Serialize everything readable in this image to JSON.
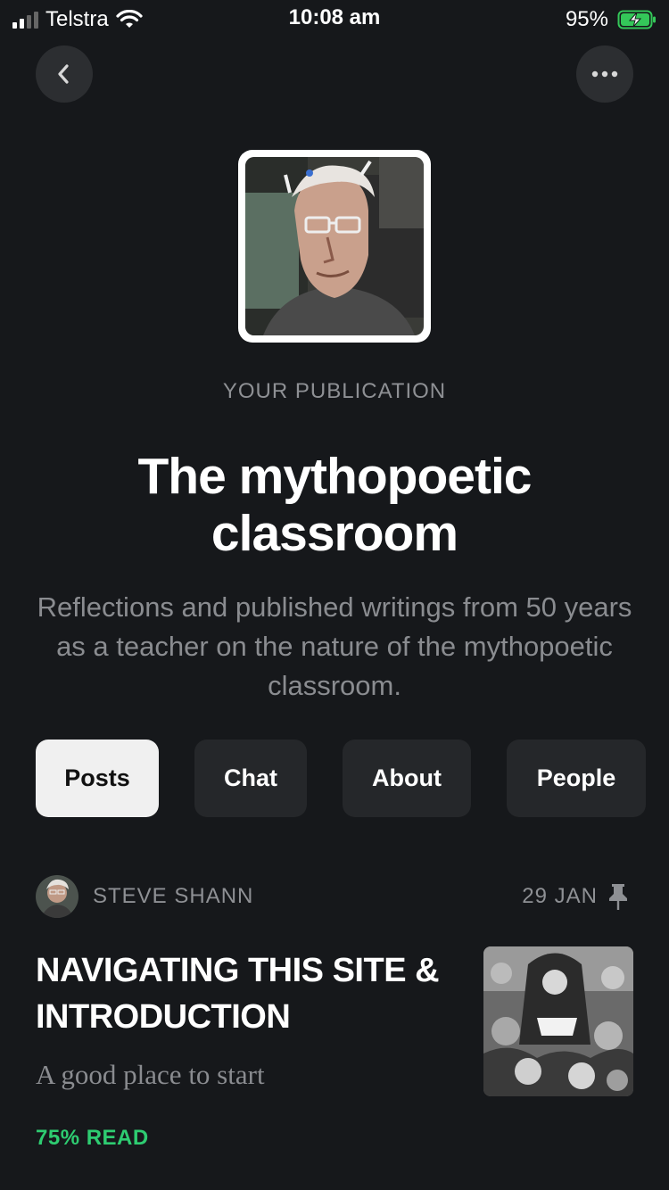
{
  "status_bar": {
    "carrier": "Telstra",
    "time": "10:08 am",
    "battery": "95%"
  },
  "nav": {
    "back_icon": "chevron-left-icon",
    "more_icon": "ellipsis-icon"
  },
  "publication": {
    "label": "YOUR PUBLICATION",
    "title": "The mythopoetic classroom",
    "description": "Reflections and published writings from 50 years as a teacher on the nature of the mythopoetic classroom."
  },
  "tabs": [
    {
      "label": "Posts",
      "active": true
    },
    {
      "label": "Chat",
      "active": false
    },
    {
      "label": "About",
      "active": false
    },
    {
      "label": "People",
      "active": false
    }
  ],
  "post": {
    "author": "STEVE SHANN",
    "date": "29 JAN",
    "title": "NAVIGATING THIS SITE & INTRODUCTION",
    "subtitle": "A good place to start",
    "progress": "75% READ",
    "pinned": true
  },
  "colors": {
    "background": "#16181b",
    "accent_green": "#2ecc71",
    "tab_active_bg": "#f0f0f0",
    "tab_bg": "#25272a"
  }
}
